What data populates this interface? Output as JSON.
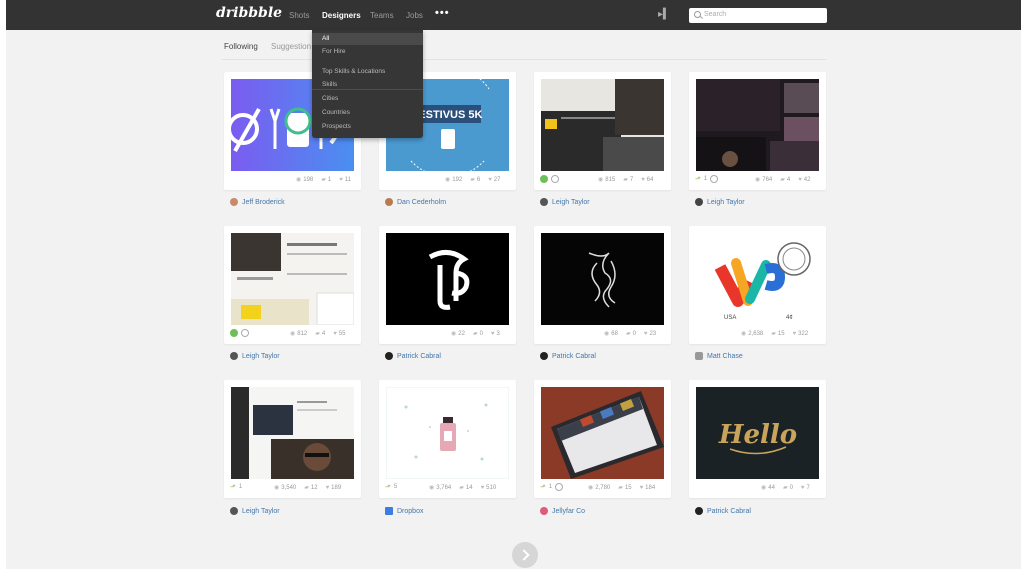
{
  "brand": {
    "logo_text": "dribbble"
  },
  "nav": {
    "items": [
      "Shots",
      "Designers",
      "Teams",
      "Jobs"
    ],
    "active": "Designers",
    "more": "•••"
  },
  "search": {
    "placeholder": "Search"
  },
  "tabs": {
    "following": "Following",
    "suggestions": "Suggestion"
  },
  "dropdown": {
    "items": [
      "All",
      "For Hire",
      "Top Skills & Locations",
      "Skills",
      "Cities",
      "Countries",
      "Prospects"
    ],
    "active": "All"
  },
  "colors": {
    "topbar": "#333333",
    "page": "#f2f2f2",
    "link": "#4477aa",
    "rebound": "#6cbf5a"
  },
  "shots": [
    {
      "player": "Jeff Broderick",
      "views": "198",
      "comments": "1",
      "likes": "11",
      "extras": []
    },
    {
      "player": "Dan Cederholm",
      "views": "192",
      "comments": "6",
      "likes": "27",
      "extras": [],
      "art": "FESTIVUS 5K"
    },
    {
      "player": "Leigh Taylor",
      "views": "815",
      "comments": "7",
      "likes": "64",
      "extras": [
        "rebound",
        "link"
      ]
    },
    {
      "player": "Leigh Taylor",
      "views": "764",
      "comments": "4",
      "likes": "42",
      "extras": [
        "up"
      ],
      "up_count": "1"
    },
    {
      "player": "Leigh Taylor",
      "views": "812",
      "comments": "4",
      "likes": "55",
      "extras": [
        "rebound",
        "link"
      ]
    },
    {
      "player": "Patrick Cabral",
      "views": "22",
      "comments": "0",
      "likes": "3",
      "extras": []
    },
    {
      "player": "Patrick Cabral",
      "views": "68",
      "comments": "0",
      "likes": "23",
      "extras": []
    },
    {
      "player": "Matt Chase",
      "views": "2,638",
      "comments": "15",
      "likes": "322",
      "extras": [],
      "art_labels": [
        "USA",
        "4¢"
      ]
    },
    {
      "player": "Leigh Taylor",
      "views": "3,540",
      "comments": "12",
      "likes": "189",
      "extras": [
        "up"
      ],
      "up_count": "1"
    },
    {
      "player": "Dropbox",
      "views": "3,764",
      "comments": "14",
      "likes": "510",
      "extras": [
        "up"
      ],
      "up_count": "5"
    },
    {
      "player": "Jellyfar Co",
      "views": "2,780",
      "comments": "15",
      "likes": "184",
      "extras": [
        "up",
        "link"
      ],
      "up_count": "1"
    },
    {
      "player": "Patrick Cabral",
      "views": "44",
      "comments": "0",
      "likes": "7",
      "extras": [],
      "art": "Hello"
    }
  ],
  "icons": {
    "views": "eye-icon",
    "comments": "comment-icon",
    "likes": "heart-icon",
    "pager": "chevron-right-icon"
  }
}
